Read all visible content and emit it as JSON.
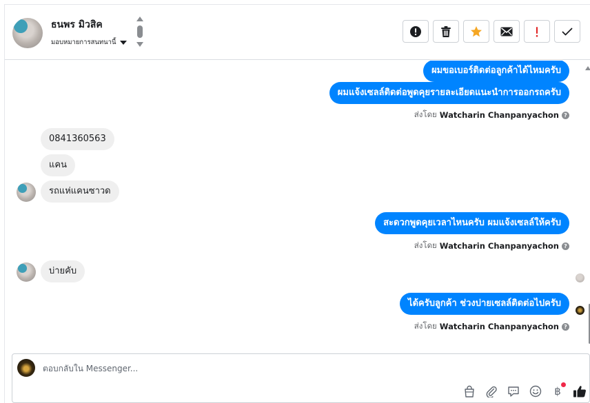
{
  "header": {
    "contact_name": "ธนพร มิวสิค",
    "assign_label": "มอบหมายการสนทนานี้",
    "actions": [
      {
        "name": "report-spam-button",
        "icon": "alert-circle-icon"
      },
      {
        "name": "delete-button",
        "icon": "trash-icon"
      },
      {
        "name": "star-button",
        "icon": "star-icon",
        "color": "#f5a623"
      },
      {
        "name": "mark-unread-button",
        "icon": "envelope-icon"
      },
      {
        "name": "follow-up-button",
        "icon": "exclamation-icon",
        "color": "#e02020"
      },
      {
        "name": "mark-done-button",
        "icon": "checkmark-icon"
      }
    ]
  },
  "messages": [
    {
      "side": "out",
      "text": "ผมขอเบอร์ติดต่อลูกค้าได้ไหมครับ"
    },
    {
      "side": "out",
      "text": "ผมแจ้งเซลล์ติดต่อพูดคุยรายละเอียดแนะนำการออกรถครับ"
    },
    {
      "side": "sent_by",
      "prefix": "ส่งโดย",
      "name": "Watcharin Chanpanyachon"
    },
    {
      "side": "in",
      "text": "0841360563"
    },
    {
      "side": "in",
      "text": "แคน"
    },
    {
      "side": "in",
      "text": "รถแห่แคนซาวด"
    },
    {
      "side": "out",
      "text": "สะดวกพูดคุยเวลาไหนครับ ผมแจ้งเซลล์ให้ครับ"
    },
    {
      "side": "sent_by",
      "prefix": "ส่งโดย",
      "name": "Watcharin Chanpanyachon"
    },
    {
      "side": "in",
      "text": "บ่ายคับ"
    },
    {
      "side": "out",
      "text": "ได้ครับลูกค้า ช่วงบ่ายเซลล์ติดต่อไปครับ"
    },
    {
      "side": "sent_by",
      "prefix": "ส่งโดย",
      "name": "Watcharin Chanpanyachon"
    }
  ],
  "composer": {
    "placeholder": "ตอบกลับใน Messenger...",
    "tools": [
      "shopping-bag-icon",
      "paperclip-icon",
      "saved-reply-icon",
      "emoji-icon",
      "baht-icon",
      "thumbs-up-icon"
    ],
    "baht_symbol": "฿"
  },
  "colors": {
    "outgoing_bubble": "#0084ff",
    "incoming_bubble": "#efefef",
    "notification_dot": "#f02849"
  }
}
